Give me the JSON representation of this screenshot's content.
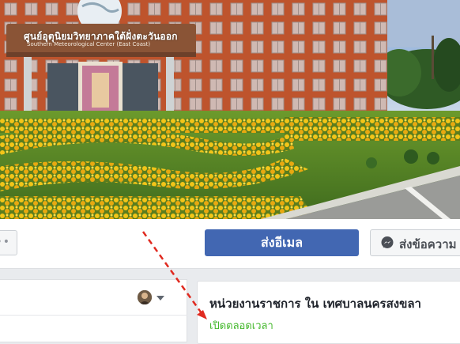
{
  "cover": {
    "sign_thai": "ศูนย์อุตุนิยมวิทยาภาคใต้ฝั่งตะวันออก",
    "sign_english": "Southern Meteorological Center (East Coast)"
  },
  "actions": {
    "more_label": "•••",
    "email_label": "ส่งอีเมล",
    "message_label": "ส่งข้อความ"
  },
  "page_info": {
    "category": "หน่วยงานราชการ ใน เทศบาลนครสงขลา",
    "open_status": "เปิดตลอดเวลา"
  },
  "colors": {
    "primary_button": "#4267b2",
    "open_status": "#42b72a",
    "annotation_arrow": "#e02a20"
  },
  "icons": {
    "messenger": "messenger-icon",
    "caret": "caret-down-icon"
  }
}
